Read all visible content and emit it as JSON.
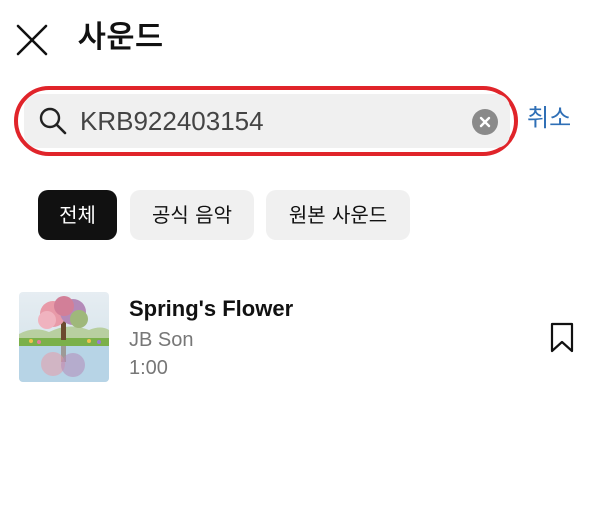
{
  "header": {
    "title": "사운드"
  },
  "search": {
    "value": "KRB922403154",
    "cancel_label": "취소",
    "highlight_color": "#e0242a"
  },
  "filters": {
    "chips": [
      {
        "label": "전체",
        "selected": true
      },
      {
        "label": "공식 음악",
        "selected": false
      },
      {
        "label": "원본 사운드",
        "selected": false
      }
    ]
  },
  "results": [
    {
      "title": "Spring's Flower",
      "artist": "JB Son",
      "duration": "1:00",
      "thumbnail_icon": "tree-artwork",
      "bookmark_icon": "bookmark-icon"
    }
  ],
  "colors": {
    "accent_link": "#2f6fb6",
    "chip_active_bg": "#111111",
    "chip_bg": "#f0f0f0"
  }
}
